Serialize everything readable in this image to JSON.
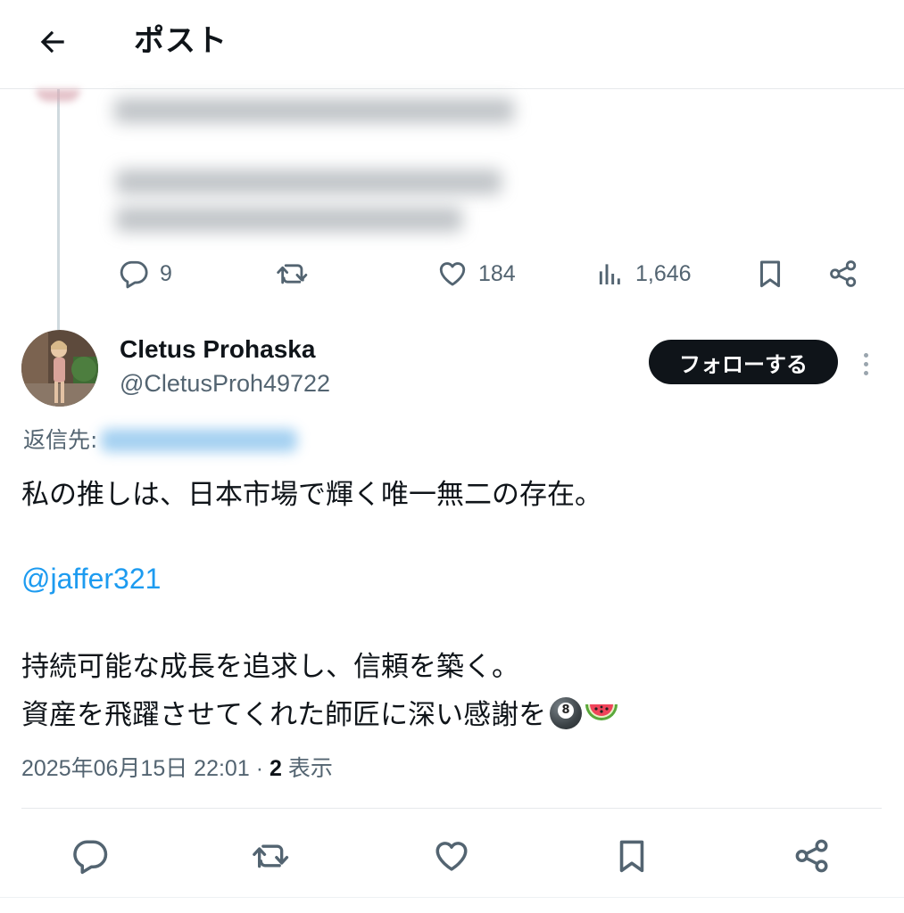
{
  "header": {
    "title": "ポスト"
  },
  "parent_post": {
    "stats": {
      "replies": "9",
      "likes": "184",
      "views": "1,646"
    }
  },
  "post": {
    "author": {
      "display_name": "Cletus Prohaska",
      "handle": "@CletusProh49722"
    },
    "follow_label": "フォローする",
    "reply_to_label": "返信先:",
    "lines": {
      "line1": "私の推しは、日本市場で輝く唯一無二の存在。",
      "mention": "@jaffer321",
      "line3": "持続可能な成長を追求し、信頼を築く。",
      "line4": "資産を飛躍させてくれた師匠に深い感謝を"
    },
    "timestamp": "2025年06月15日 22:01",
    "separator": " · ",
    "view_count": "2",
    "view_label": " 表示"
  },
  "icons": {
    "back": "arrow-left-icon",
    "reply": "comment-icon",
    "repost": "repost-icon",
    "like": "heart-icon",
    "views": "bar-chart-icon",
    "bookmark": "bookmark-icon",
    "share": "share-icon",
    "more": "more-vertical-icon",
    "emoji": [
      "8-ball-emoji",
      "watermelon-emoji"
    ]
  },
  "colors": {
    "accent": "#1d9bf0",
    "text": "#0f1419",
    "muted": "#536471",
    "follow_bg": "#0f1419"
  }
}
